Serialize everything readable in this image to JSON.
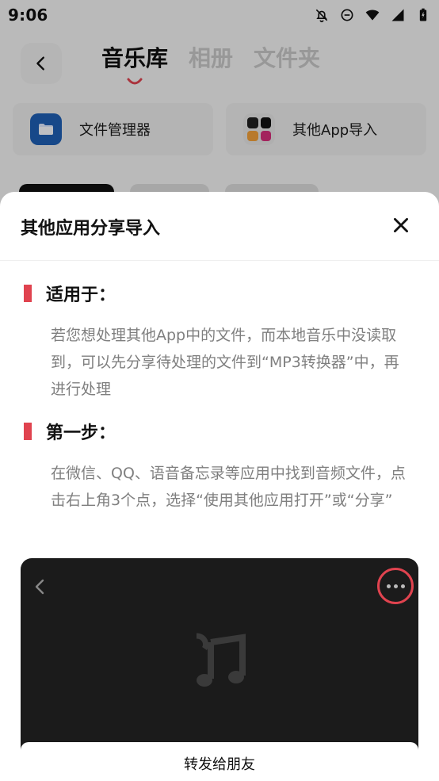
{
  "status_bar": {
    "time": "9:06"
  },
  "header": {
    "tabs": [
      {
        "label": "音乐库",
        "active": true
      },
      {
        "label": "相册",
        "active": false
      },
      {
        "label": "文件夹",
        "active": false
      }
    ]
  },
  "sources": [
    {
      "label": "文件管理器",
      "icon": "folder-icon"
    },
    {
      "label": "其他App导入",
      "icon": "apps-grid-icon"
    }
  ],
  "sheet": {
    "title": "其他应用分享导入",
    "sections": [
      {
        "title": "适用于：",
        "body": "若您想处理其他App中的文件，而本地音乐中没读取到，可以先分享待处理的文件到“MP3转换器”中，再进行处理"
      },
      {
        "title": "第一步：",
        "body": "在微信、QQ、语音备忘录等应用中找到音频文件，点击右上角3个点，选择“使用其他应用打开”或“分享”"
      }
    ],
    "preview": {
      "panel_text": "转发给朋友"
    }
  },
  "colors": {
    "accent": "#e0434f",
    "folder_blue": "#1f5fb5",
    "preview_bg": "#1b1b1b"
  }
}
